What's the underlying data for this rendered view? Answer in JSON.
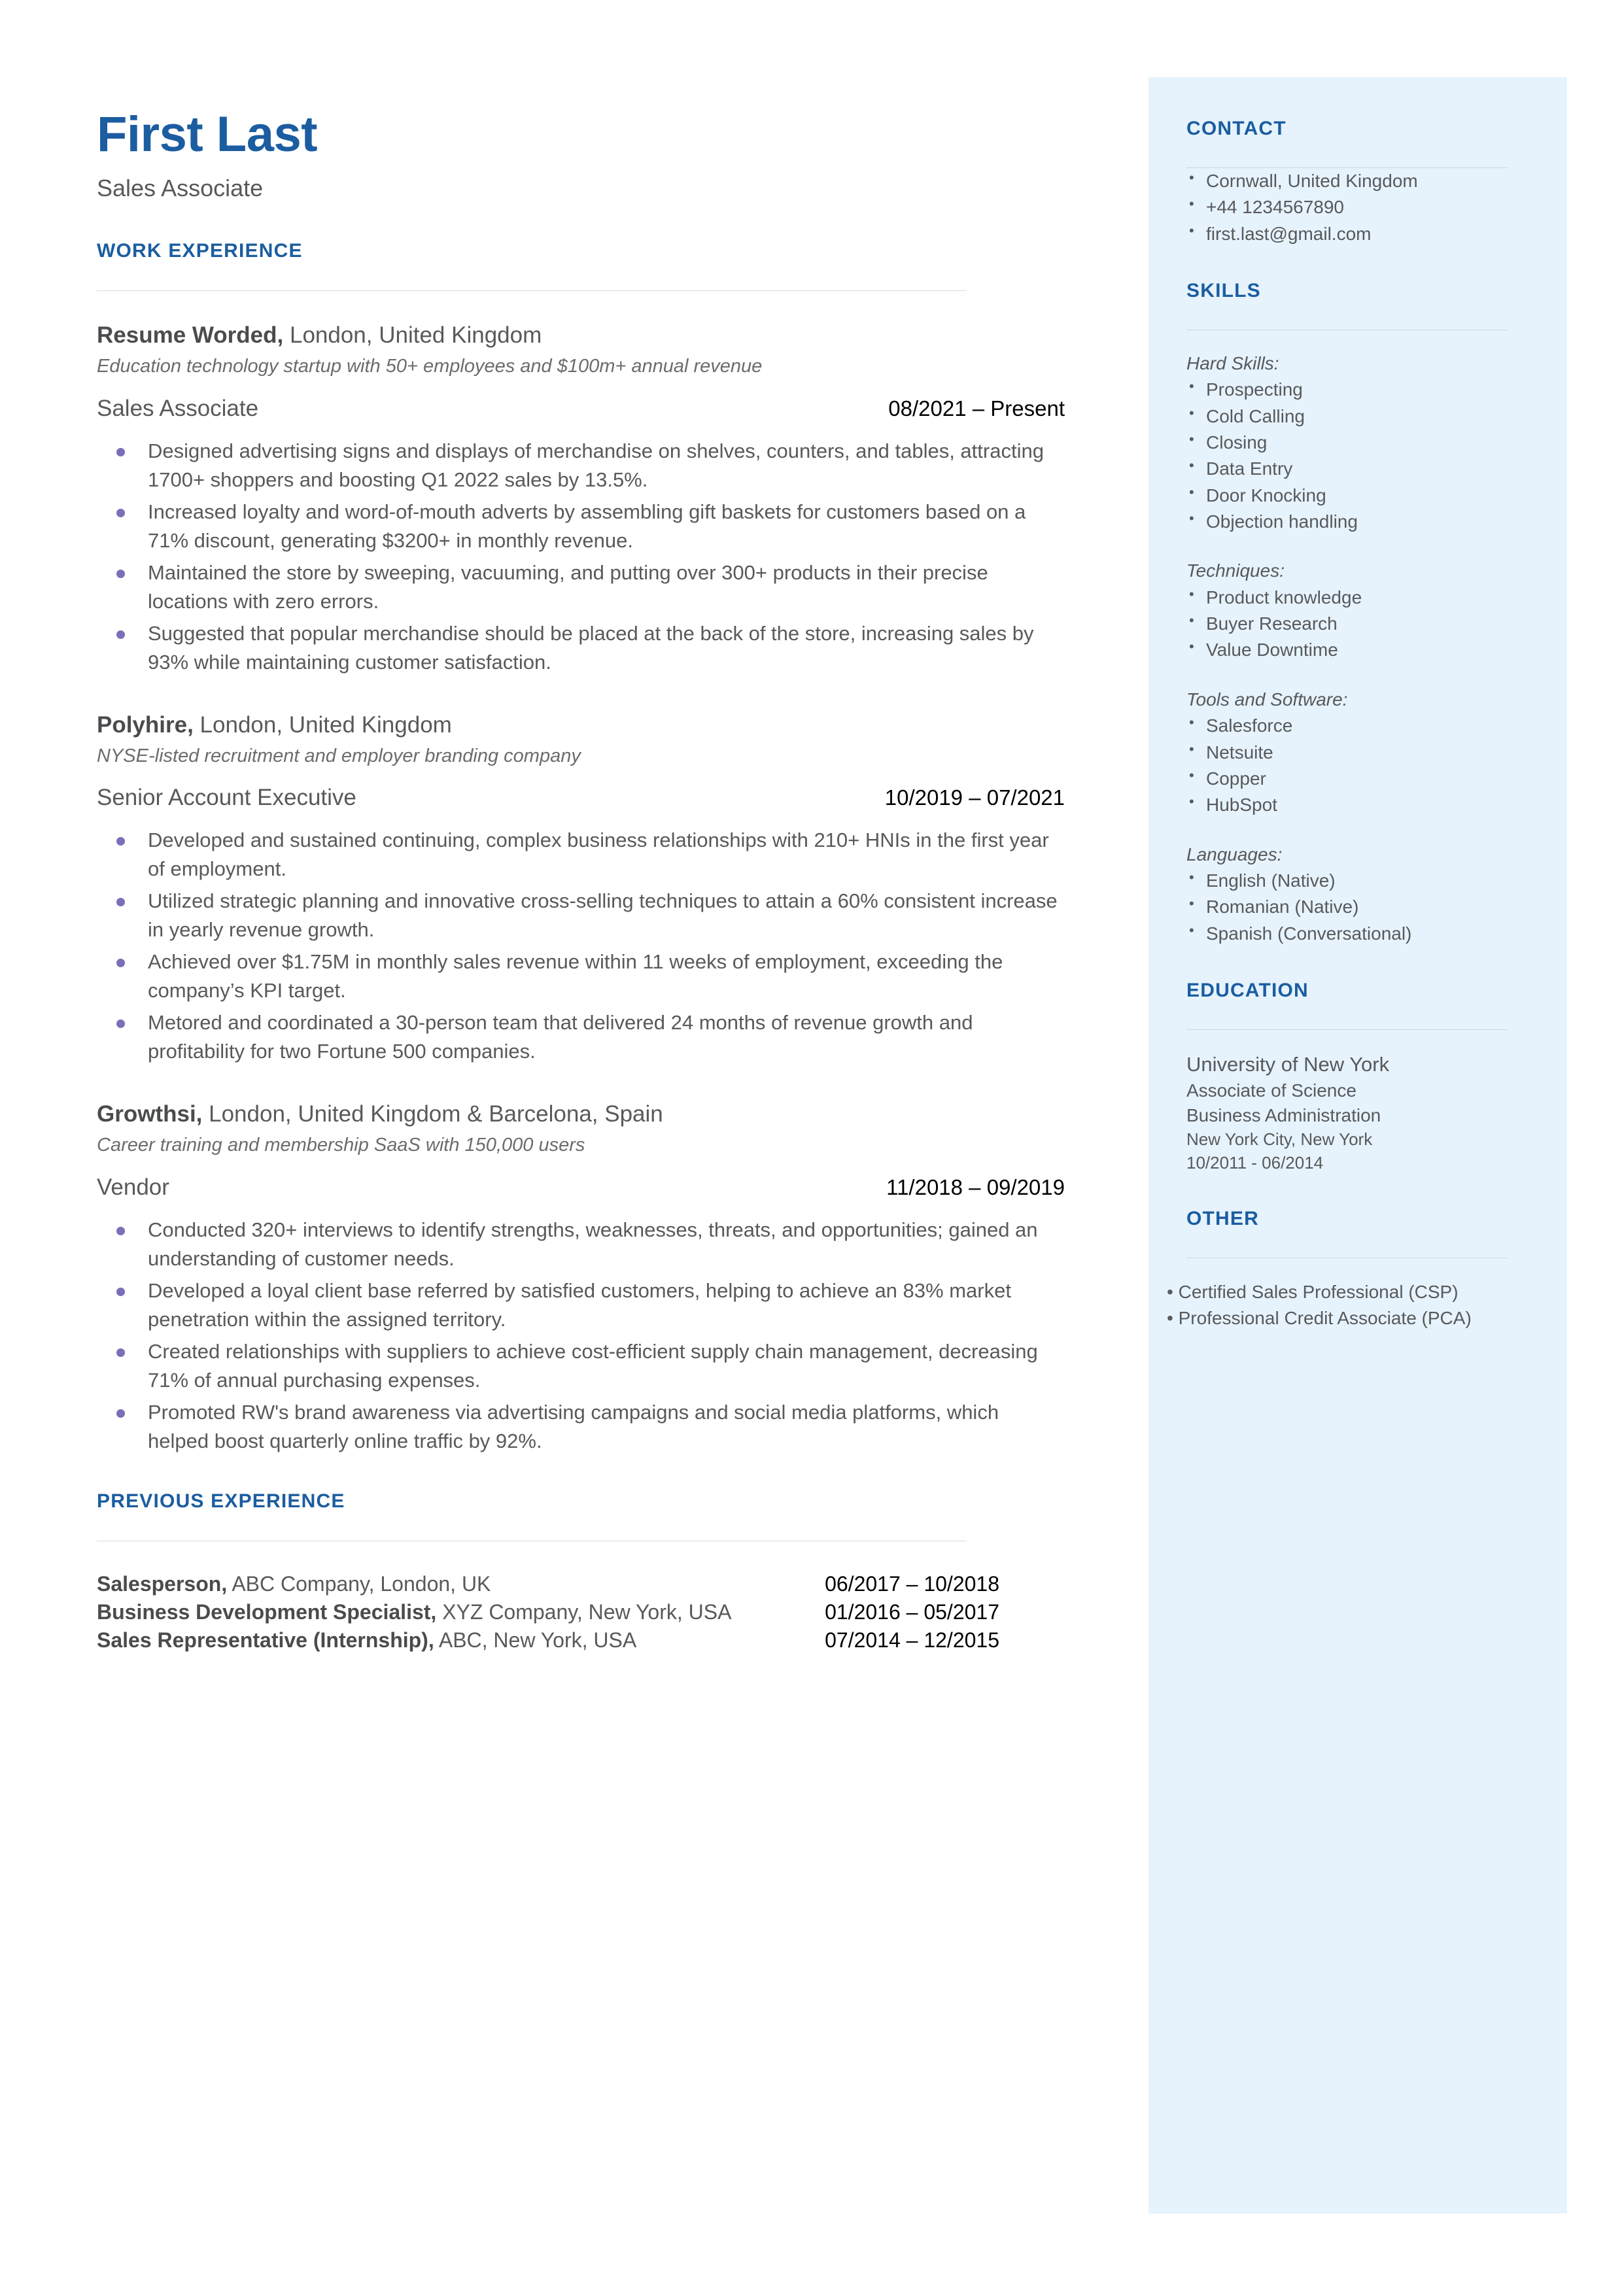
{
  "colors": {
    "accent": "#1B5DA0",
    "sidebar_bg": "#E6F3FD",
    "body_text": "#58595B",
    "bullet": "#7B6FB8",
    "rule": "#D9DCDF"
  },
  "header": {
    "name": "First Last",
    "role": "Sales Associate"
  },
  "work": {
    "heading": "WORK EXPERIENCE",
    "jobs": [
      {
        "company": "Resume Worded,",
        "location": " London, United Kingdom",
        "description": "Education technology startup with 50+ employees and $100m+ annual revenue",
        "title": "Sales Associate",
        "dates": "08/2021 – Present",
        "bullets": [
          "Designed advertising signs and displays of merchandise on shelves, counters, and tables, attracting 1700+ shoppers and boosting Q1 2022 sales by 13.5%.",
          "Increased loyalty and word-of-mouth adverts by assembling gift baskets for customers based on a 71% discount, generating $3200+ in monthly revenue.",
          "Maintained the store by sweeping, vacuuming, and putting over 300+ products in their precise locations with zero errors.",
          "Suggested that popular merchandise should be placed at the back of the store, increasing sales by 93% while maintaining customer satisfaction."
        ]
      },
      {
        "company": "Polyhire,",
        "location": " London, United Kingdom",
        "description": "NYSE-listed recruitment and employer branding company",
        "title": "Senior Account Executive",
        "dates": "10/2019 – 07/2021",
        "bullets": [
          "Developed and sustained continuing, complex business relationships with 210+ HNIs in the first year of employment.",
          "Utilized strategic planning and innovative cross-selling techniques to attain a 60% consistent increase in yearly revenue growth.",
          "Achieved over $1.75M in monthly sales revenue within 11 weeks of employment, exceeding the company’s KPI target.",
          "Metored and coordinated a 30-person team that delivered 24 months of revenue growth and profitability for two Fortune 500 companies."
        ]
      },
      {
        "company": "Growthsi,",
        "location": " London, United Kingdom & Barcelona, Spain",
        "description": "Career training and membership SaaS with 150,000 users",
        "title": "Vendor",
        "dates": "11/2018 – 09/2019",
        "bullets": [
          "Conducted 320+ interviews to identify strengths, weaknesses, threats, and opportunities; gained an understanding of customer needs.",
          "Developed a loyal client base referred by satisfied customers, helping to achieve an 83% market penetration within the assigned territory.",
          "Created relationships with suppliers to achieve cost-efficient supply chain management, decreasing 71% of annual purchasing expenses.",
          "Promoted RW's brand awareness via advertising campaigns and social media platforms, which helped boost quarterly online traffic by 92%."
        ]
      }
    ]
  },
  "previous": {
    "heading": "PREVIOUS EXPERIENCE",
    "rows": [
      {
        "title": "Salesperson,",
        "detail": " ABC Company, London, UK",
        "dates": "06/2017 – 10/2018"
      },
      {
        "title": "Business Development Specialist,",
        "detail": " XYZ Company, New York, USA",
        "dates": "01/2016 – 05/2017"
      },
      {
        "title": "Sales Representative (Internship),",
        "detail": " ABC, New York, USA",
        "dates": "07/2014 – 12/2015"
      }
    ]
  },
  "sidebar": {
    "contact": {
      "heading": "CONTACT",
      "items": [
        "Cornwall, United Kingdom",
        "+44 1234567890",
        "first.last@gmail.com"
      ]
    },
    "skills": {
      "heading": "SKILLS",
      "groups": [
        {
          "label": "Hard Skills:",
          "items": [
            "Prospecting",
            "Cold Calling",
            "Closing",
            "Data Entry",
            "Door Knocking",
            "Objection handling"
          ]
        },
        {
          "label": "Techniques:",
          "items": [
            "Product knowledge",
            "Buyer Research",
            "Value Downtime"
          ]
        },
        {
          "label": "Tools and Software:",
          "items": [
            "Salesforce",
            "Netsuite",
            "Copper",
            "HubSpot"
          ]
        },
        {
          "label": "Languages:",
          "items": [
            "English (Native)",
            "Romanian (Native)",
            "Spanish (Conversational)"
          ]
        }
      ]
    },
    "education": {
      "heading": "EDUCATION",
      "school": "University of New York",
      "degree": "Associate of Science",
      "field": "Business Administration",
      "location": "New York City, New York",
      "dates": "10/2011 - 06/2014"
    },
    "other": {
      "heading": "OTHER",
      "items": [
        "Certified Sales Professional (CSP)",
        "Professional Credit Associate (PCA)"
      ]
    }
  }
}
